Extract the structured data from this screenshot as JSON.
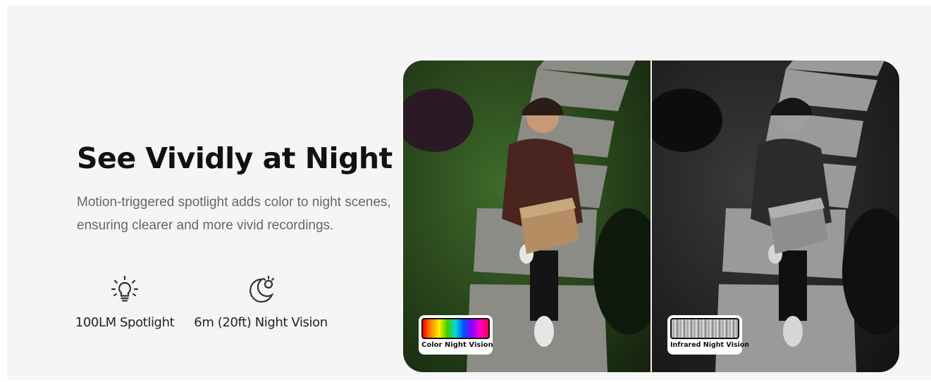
{
  "headline": "See Vividly at Night",
  "description": "Motion-triggered spotlight adds color to night scenes, ensuring clearer and more vivid recordings.",
  "features": [
    {
      "icon": "lightbulb-icon",
      "label": "100LM Spotlight"
    },
    {
      "icon": "moon-icon",
      "label": "6m (20ft) Night Vision"
    }
  ],
  "comparison": {
    "left_badge": "Color Night Vision",
    "right_badge": "Infrared Night Vision"
  },
  "colors": {
    "panel_bg": "#f5f5f5",
    "headline": "#111111",
    "body_text": "#666666"
  }
}
